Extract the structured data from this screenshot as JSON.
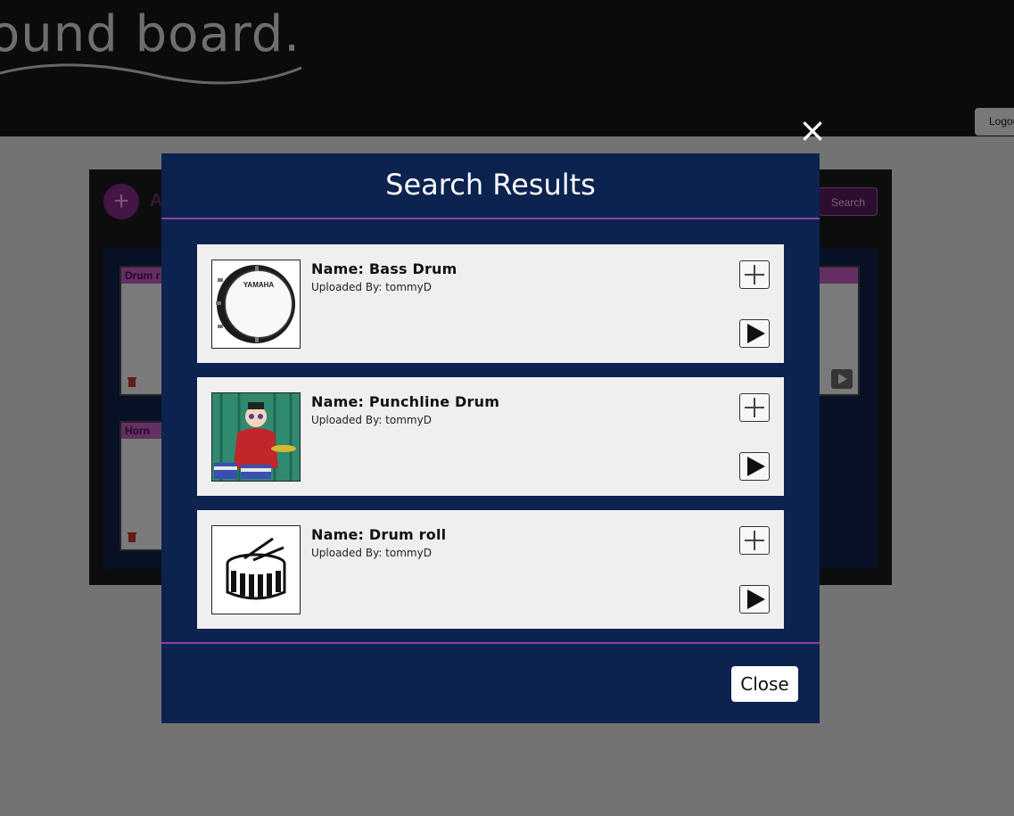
{
  "app": {
    "logo_text": "ound board.",
    "logout_label": "Logout"
  },
  "board": {
    "add_label": "A",
    "search_label": "Search",
    "cards": [
      {
        "label": "Drum r"
      },
      {
        "label": "Horn"
      }
    ]
  },
  "modal": {
    "title": "Search Results",
    "close_x": "×",
    "close_label": "Close",
    "results": [
      {
        "name": "Name: Bass Drum",
        "uploader": "Uploaded By: tommyD",
        "image_icon": "bass-drum-icon"
      },
      {
        "name": "Name: Punchline Drum",
        "uploader": "Uploaded By: tommyD",
        "image_icon": "drummer-cartoon-icon"
      },
      {
        "name": "Name: Drum roll",
        "uploader": "Uploaded By: tommyD",
        "image_icon": "snare-drum-icon"
      }
    ]
  },
  "colors": {
    "topbar": "#161616",
    "modal_bg": "#0c2350",
    "accent_purple": "#8e3fa3",
    "card_bg": "#efefef"
  }
}
